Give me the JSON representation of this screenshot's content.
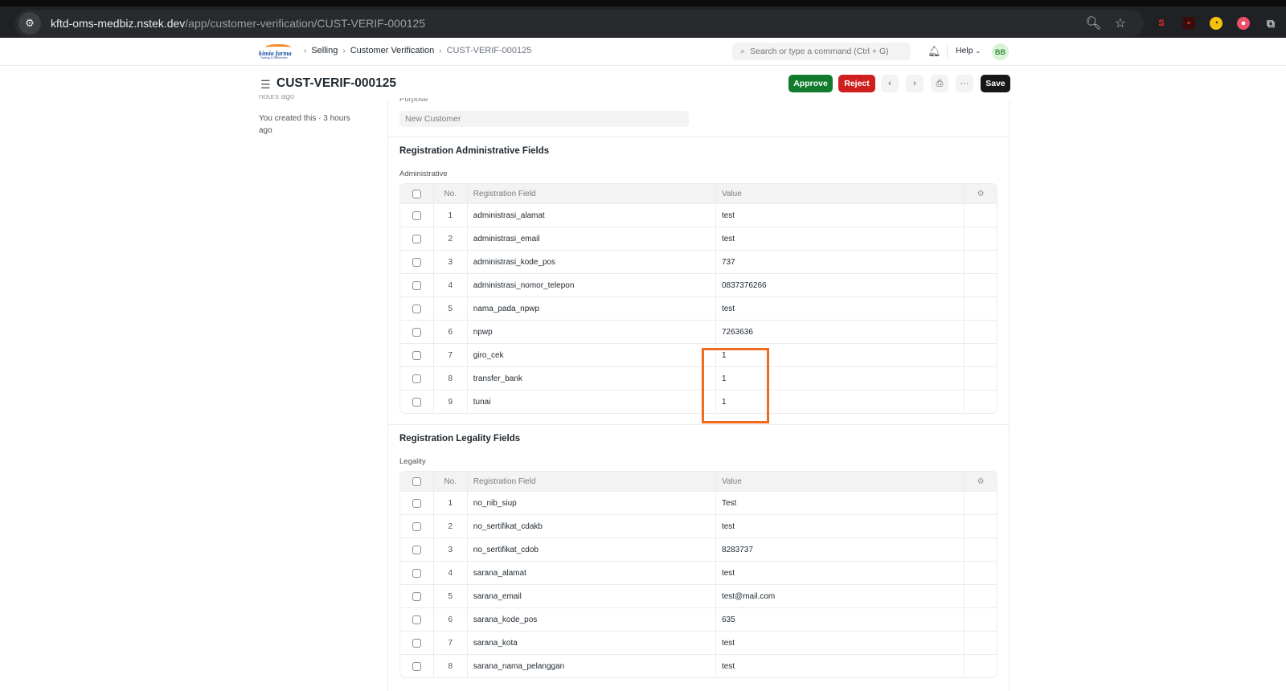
{
  "browser": {
    "url_host": "kftd-oms-medbiz.nstek.dev",
    "url_path": "/app/customer-verification/CUST-VERIF-000125"
  },
  "navbar": {
    "logo_text": "kimia farma",
    "logo_sub": "Trading & Distribution",
    "breadcrumbs": [
      "Selling",
      "Customer Verification",
      "CUST-VERIF-000125"
    ],
    "search_placeholder": "Search or type a command (Ctrl + G)",
    "help_label": "Help",
    "avatar_initials": "BB"
  },
  "page": {
    "title": "CUST-VERIF-000125",
    "approve_label": "Approve",
    "reject_label": "Reject",
    "save_label": "Save"
  },
  "sidebar": {
    "cut_text": "hours ago",
    "activity": "You created this · 3 hours ago"
  },
  "form": {
    "purpose_label": "Purpose",
    "purpose_value": "New Customer",
    "administrative": {
      "section_title": "Registration Administrative Fields",
      "table_label": "Administrative",
      "columns": {
        "no": "No.",
        "field": "Registration Field",
        "value": "Value"
      },
      "rows": [
        {
          "no": "1",
          "field": "administrasi_alamat",
          "value": "test"
        },
        {
          "no": "2",
          "field": "administrasi_email",
          "value": "test"
        },
        {
          "no": "3",
          "field": "administrasi_kode_pos",
          "value": "737"
        },
        {
          "no": "4",
          "field": "administrasi_nomor_telepon",
          "value": "0837376266"
        },
        {
          "no": "5",
          "field": "nama_pada_npwp",
          "value": "test"
        },
        {
          "no": "6",
          "field": "npwp",
          "value": "7263636"
        },
        {
          "no": "7",
          "field": "giro_cek",
          "value": "1"
        },
        {
          "no": "8",
          "field": "transfer_bank",
          "value": "1"
        },
        {
          "no": "9",
          "field": "tunai",
          "value": "1"
        }
      ]
    },
    "legality": {
      "section_title": "Registration Legality Fields",
      "table_label": "Legality",
      "columns": {
        "no": "No.",
        "field": "Registration Field",
        "value": "Value"
      },
      "rows": [
        {
          "no": "1",
          "field": "no_nib_siup",
          "value": "Test"
        },
        {
          "no": "2",
          "field": "no_sertifikat_cdakb",
          "value": "test"
        },
        {
          "no": "3",
          "field": "no_sertifikat_cdob",
          "value": "8283737"
        },
        {
          "no": "4",
          "field": "sarana_alamat",
          "value": "test"
        },
        {
          "no": "5",
          "field": "sarana_email",
          "value": "test@mail.com"
        },
        {
          "no": "6",
          "field": "sarana_kode_pos",
          "value": "635"
        },
        {
          "no": "7",
          "field": "sarana_kota",
          "value": "test"
        },
        {
          "no": "8",
          "field": "sarana_nama_pelanggan",
          "value": "test"
        }
      ]
    }
  }
}
